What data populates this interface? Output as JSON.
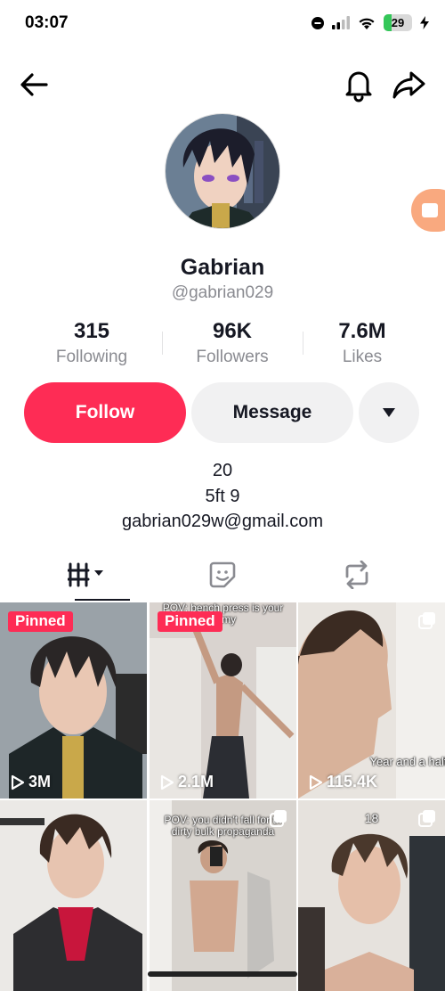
{
  "status_bar": {
    "time": "03:07",
    "battery": "29",
    "battery_level": 0.29
  },
  "profile": {
    "display_name": "Gabrian",
    "username": "@gabrian029",
    "stats": [
      {
        "value": "315",
        "label": "Following"
      },
      {
        "value": "96K",
        "label": "Followers"
      },
      {
        "value": "7.6M",
        "label": "Likes"
      }
    ],
    "bio_lines": [
      "20",
      "5ft 9",
      "gabrian029w@gmail.com"
    ]
  },
  "actions": {
    "follow": "Follow",
    "message": "Message"
  },
  "videos": [
    {
      "pinned": "Pinned",
      "views": "3M",
      "overlay": ""
    },
    {
      "pinned": "Pinned",
      "views": "2.1M",
      "overlay": "POV: bench press is your\nnemy"
    },
    {
      "pinned": "",
      "views": "115.4K",
      "overlay": "Year and a half"
    },
    {
      "pinned": "",
      "views": "",
      "overlay": ""
    },
    {
      "pinned": "",
      "views": "",
      "overlay": "POV: you didn't fall for th\ndirty bulk propaganda"
    },
    {
      "pinned": "",
      "views": "",
      "overlay": "18"
    }
  ],
  "colors": {
    "accent": "#fe2c55",
    "button_bg": "#f1f1f2",
    "secondary_text": "#8a8b91"
  },
  "icons": [
    "back-arrow-icon",
    "bell-icon",
    "share-icon",
    "video-camera-icon",
    "grid-icon",
    "liked-icon",
    "repost-icon",
    "play-icon",
    "multi-image-icon"
  ]
}
